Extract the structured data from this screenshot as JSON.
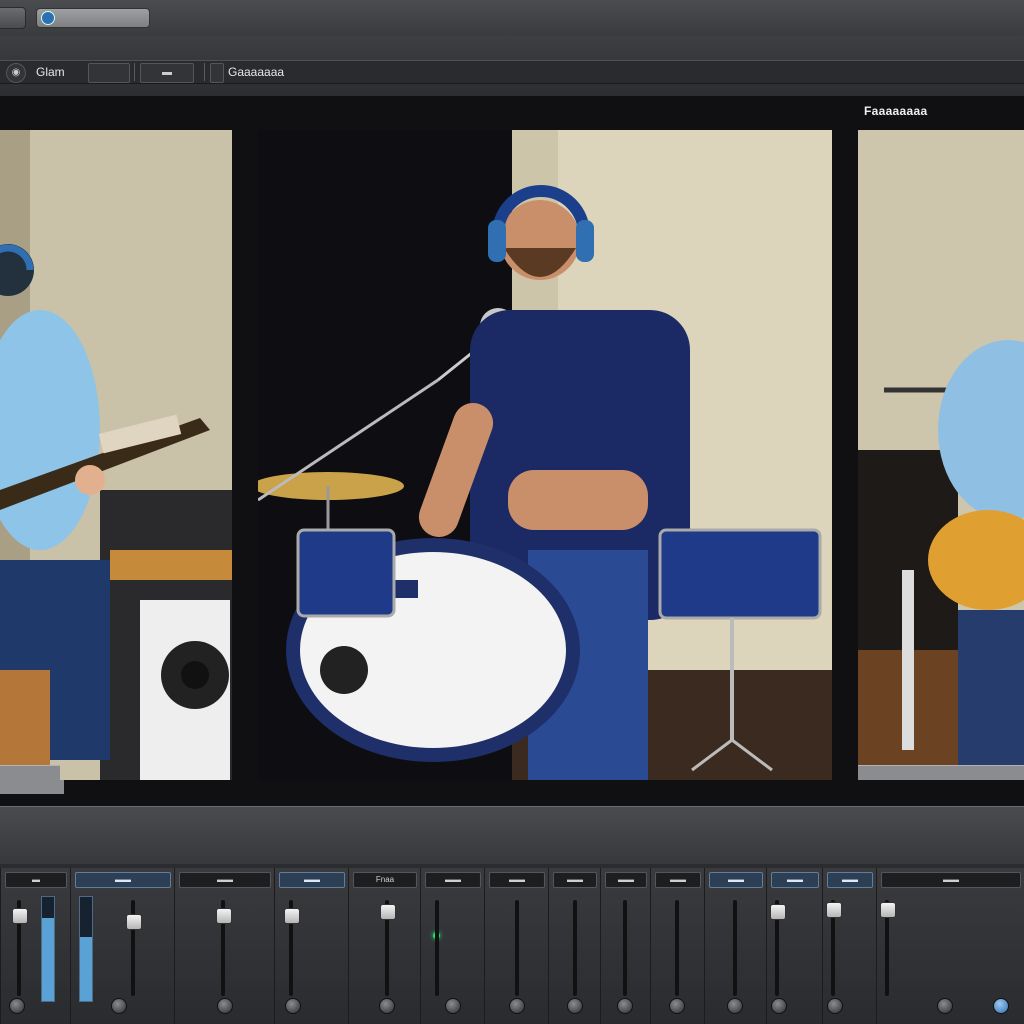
{
  "toolbar": {
    "project_label": "Glam",
    "mode_label": "Gaaaaaaa"
  },
  "viewer": {
    "caption": "Faaaaaaaa"
  },
  "mixer": {
    "channels": [
      {
        "label": "▬"
      },
      {
        "label": "▬▬"
      },
      {
        "label": "▬▬"
      },
      {
        "label": "▬▬"
      },
      {
        "label": "Fnaa"
      },
      {
        "label": "▬▬"
      },
      {
        "label": "▬▬"
      },
      {
        "label": "▬▬"
      },
      {
        "label": "▬▬"
      },
      {
        "label": "▬▬"
      },
      {
        "label": "▬▬"
      },
      {
        "label": "▬▬"
      },
      {
        "label": "▬▬"
      },
      {
        "label": "▬▬"
      }
    ]
  },
  "colors": {
    "accent_blue": "#5aa1d6",
    "level_led": "#1ee06a"
  },
  "icons": [
    "record-icon",
    "headphones-icon"
  ]
}
